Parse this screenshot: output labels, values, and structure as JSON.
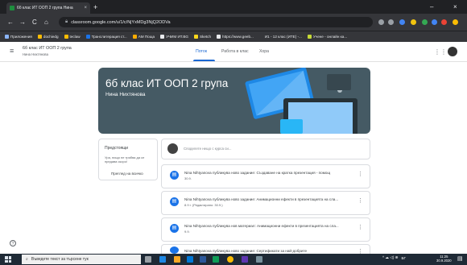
{
  "browser": {
    "tab_title": "6б клас ИТ ООП 2 група Нина",
    "tab_close": "×",
    "new_tab": "+",
    "minimize": "–",
    "close": "×",
    "back": "←",
    "forward": "→",
    "reload": "C",
    "home": "⌂",
    "url": "classroom.google.com/u/1/c/NjYxMDg3NjQ2ODVa",
    "bookmarks": [
      {
        "label": "Приложения",
        "color": "#8ab4f8"
      },
      {
        "label": "dochiedg",
        "color": "#fbbc04"
      },
      {
        "label": "teclaw",
        "color": "#fbbc04"
      },
      {
        "label": "Транслитерация ст...",
        "color": "#1a73e8"
      },
      {
        "label": "АМ Поща",
        "color": "#f9ab00"
      },
      {
        "label": "УЧИМ ИТ.BG",
        "color": "#e8eaed"
      },
      {
        "label": "Sketch",
        "color": "#f9d71c"
      },
      {
        "label": "https://www.geeb...",
        "color": "#e8eaed"
      },
      {
        "label": "И1 - 12 клас (ИТЕ) -...",
        "color": "#35363a"
      },
      {
        "label": "Учене - онлайн ка...",
        "color": "#c6da36"
      }
    ]
  },
  "classroom": {
    "class_name": "6б клас ИТ ООП 2 група",
    "class_sub": "Нина Нихтянова",
    "menu_icon": "≡",
    "apps_icon": "⋮⋮",
    "tabs": [
      {
        "label": "Поток"
      },
      {
        "label": "Работа в клас"
      },
      {
        "label": "Хора"
      }
    ],
    "banner": {
      "title": "6б клас ИТ ООП 2 група",
      "teacher": "Нина Нихтянова",
      "bg": "#455a64"
    },
    "upcoming": {
      "title": "Предстоящи",
      "text": "Ура, нищо не трябва да се предава скоро!",
      "view_all": "Преглед на всичко"
    },
    "share_placeholder": "Споделете нещо с курса си...",
    "posts": [
      {
        "title": "Nina Nihtyanova публикува ново задание: Създаване на кратка презентация - помощ",
        "date": "30.9."
      },
      {
        "title": "Nina Nihtyanova публикува ново задание: Анимационни ефекти в презентацията на сла...",
        "date": "8.9 г. (Редактирано: 30.9.)"
      },
      {
        "title": "Nina Nihtyanova публикува нов материал: Анимационни ефекти в презентацията на сла...",
        "date": "9.9."
      },
      {
        "title": "Nina Nihtyanova публикува ново задание: Сертификати за най-добрите",
        "date": ""
      }
    ],
    "kebab": "⋮",
    "help": "?"
  },
  "taskbar": {
    "search_placeholder": "Въведете текст за търсене тук",
    "search_icon": "⌕",
    "lang": "БГ",
    "time": "11:25",
    "date": "30.9.2020",
    "tray_icons": "^ ☁ ◁) ⊕",
    "notify": "▤"
  }
}
